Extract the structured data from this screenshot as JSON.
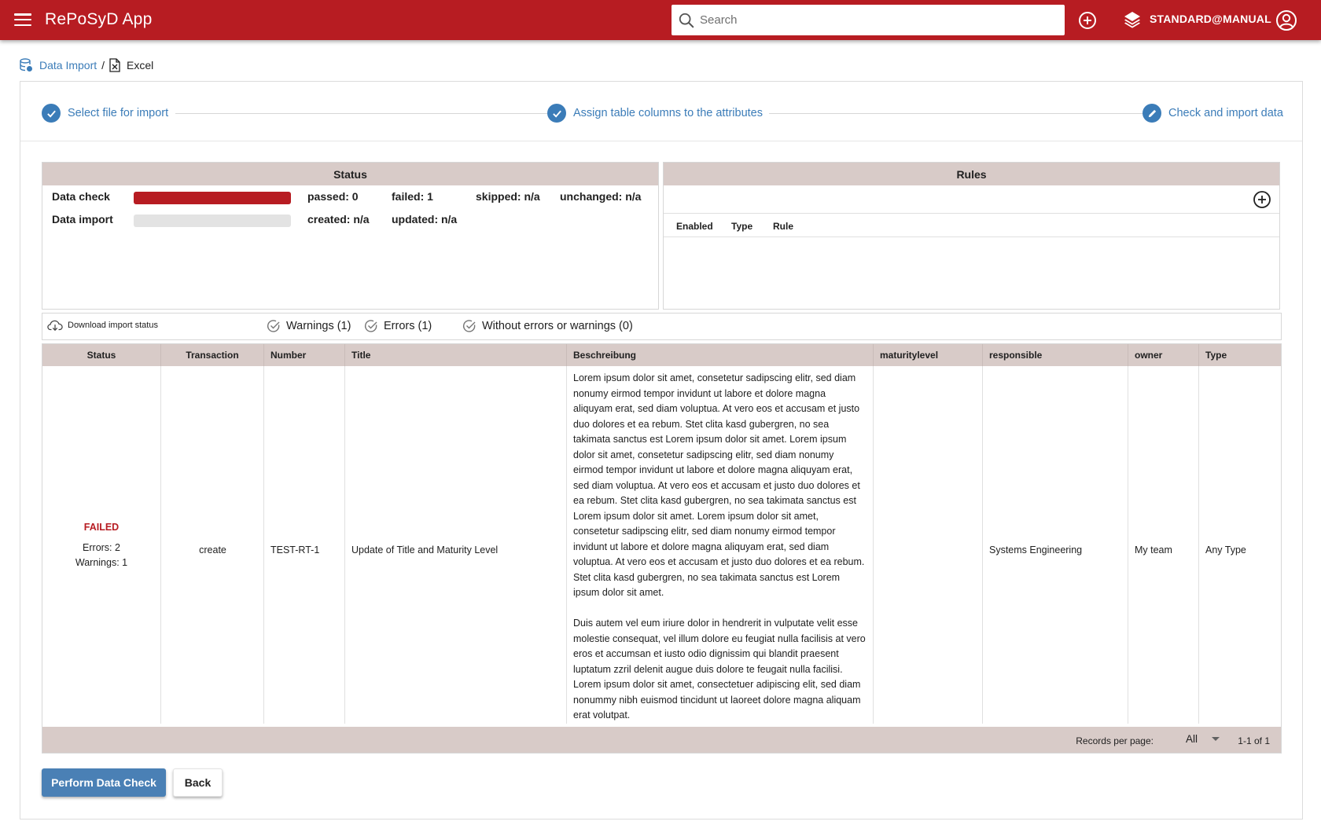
{
  "app": {
    "title": "RePoSyD App",
    "workspace": "STANDARD@MANUAL"
  },
  "search": {
    "placeholder": "Search",
    "value": ""
  },
  "breadcrumb": {
    "parent": "Data Import",
    "separator": "/",
    "current": "Excel"
  },
  "stepper": {
    "steps": [
      {
        "label": "Select file for import",
        "state": "done"
      },
      {
        "label": "Assign table columns to the attributes",
        "state": "done"
      },
      {
        "label": "Check and import data",
        "state": "edit"
      }
    ]
  },
  "status_panel": {
    "title": "Status",
    "data_check": {
      "label": "Data check",
      "progress": 1.0,
      "passed": "passed: 0",
      "failed": "failed: 1",
      "skipped": "skipped: n/a",
      "unchanged": "unchanged: n/a"
    },
    "data_import": {
      "label": "Data import",
      "progress": 0.0,
      "created": "created: n/a",
      "updated": "updated: n/a"
    }
  },
  "rules_panel": {
    "title": "Rules",
    "columns": [
      "Enabled",
      "Type",
      "Rule"
    ]
  },
  "filters": {
    "download": "Download import status",
    "warnings": "Warnings (1)",
    "errors": "Errors (1)",
    "without": "Without errors or warnings (0)"
  },
  "table": {
    "columns": [
      "Status",
      "Transaction",
      "Number",
      "Title",
      "Beschreibung",
      "maturitylevel",
      "responsible",
      "owner",
      "Type"
    ],
    "rows": [
      {
        "status": "FAILED",
        "errors": "Errors: 2",
        "warnings": "Warnings: 1",
        "transaction": "create",
        "number": "TEST-RT-1",
        "title": "Update of Title and Maturity Level",
        "description_p1": "Lorem ipsum dolor sit amet, consetetur sadipscing elitr, sed diam nonumy eirmod tempor invidunt ut labore et dolore magna aliquyam erat, sed diam voluptua. At vero eos et accusam et justo duo dolores et ea rebum. Stet clita kasd gubergren, no sea takimata sanctus est Lorem ipsum dolor sit amet. Lorem ipsum dolor sit amet, consetetur sadipscing elitr, sed diam nonumy eirmod tempor invidunt ut labore et dolore magna aliquyam erat, sed diam voluptua. At vero eos et accusam et justo duo dolores et ea rebum. Stet clita kasd gubergren, no sea takimata sanctus est Lorem ipsum dolor sit amet. Lorem ipsum dolor sit amet, consetetur sadipscing elitr, sed diam nonumy eirmod tempor invidunt ut labore et dolore magna aliquyam erat, sed diam voluptua. At vero eos et accusam et justo duo dolores et ea rebum. Stet clita kasd gubergren, no sea takimata sanctus est Lorem ipsum dolor sit amet.",
        "description_p2": "Duis autem vel eum iriure dolor in hendrerit in vulputate velit esse molestie consequat, vel illum dolore eu feugiat nulla facilisis at vero eros et accumsan et iusto odio dignissim qui blandit praesent luptatum zzril delenit augue duis dolore te feugait nulla facilisi. Lorem ipsum dolor sit amet, consectetuer adipiscing elit, sed diam nonummy nibh euismod tincidunt ut laoreet dolore magna aliquam erat volutpat.",
        "maturitylevel": "",
        "responsible": "Systems Engineering",
        "owner": "My team",
        "type": "Any Type"
      }
    ],
    "footer": {
      "records_label": "Records per page:",
      "records_value": "All",
      "range": "1-1 of 1"
    }
  },
  "actions": {
    "perform": "Perform Data Check",
    "back": "Back"
  },
  "colors": {
    "brand": "#b71c22",
    "accent": "#3b7cb8",
    "header_bg": "#d8cbc8",
    "primary_button": "#4a80b5"
  }
}
